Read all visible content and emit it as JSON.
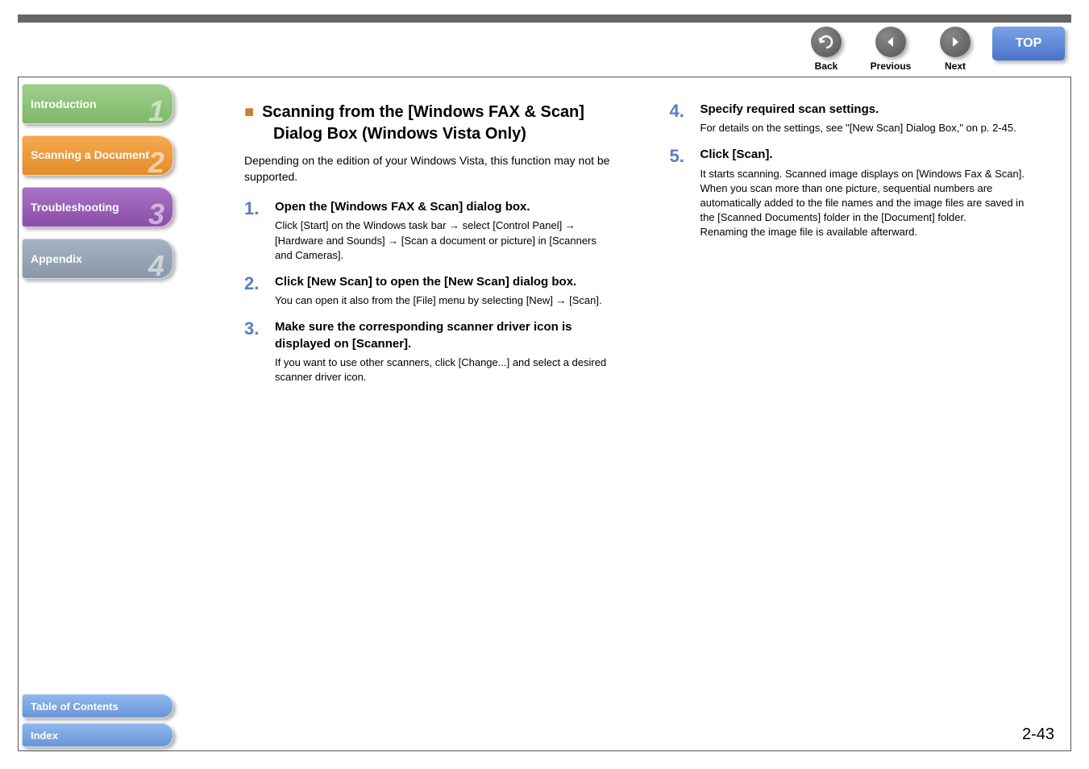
{
  "nav": {
    "back": "Back",
    "previous": "Previous",
    "next": "Next",
    "top": "TOP"
  },
  "sidebar": {
    "tabs": [
      {
        "label": "Introduction",
        "num": "1"
      },
      {
        "label": "Scanning a Document",
        "num": "2"
      },
      {
        "label": "Troubleshooting",
        "num": "3"
      },
      {
        "label": "Appendix",
        "num": "4"
      }
    ],
    "toc": "Table of Contents",
    "index": "Index"
  },
  "content": {
    "title": "Scanning from the [Windows FAX & Scan] Dialog Box (Windows Vista Only)",
    "intro": "Depending on the edition of your Windows Vista, this function may not be supported.",
    "steps": [
      {
        "num": "1.",
        "head": "Open the [Windows FAX & Scan] dialog box.",
        "desc": "Click [Start] on the Windows task bar → select [Control Panel] → [Hardware and Sounds] → [Scan a document or picture] in [Scanners and Cameras]."
      },
      {
        "num": "2.",
        "head": "Click [New Scan] to open the [New Scan] dialog box.",
        "desc": "You can open it also from the [File] menu by selecting [New] → [Scan]."
      },
      {
        "num": "3.",
        "head": "Make sure the corresponding scanner driver icon is displayed on [Scanner].",
        "desc": "If you want to use other scanners, click [Change...] and select a desired scanner driver icon."
      },
      {
        "num": "4.",
        "head": "Specify required scan settings.",
        "desc": "For details on the settings, see \"[New Scan] Dialog Box,\" on p. 2-45."
      },
      {
        "num": "5.",
        "head": "Click [Scan].",
        "desc": "It starts scanning. Scanned image displays on [Windows Fax & Scan].\nWhen you scan more than one picture, sequential numbers are automatically added to the file names and the image files are saved in the [Scanned Documents] folder in the [Document] folder.\nRenaming the image file is available afterward."
      }
    ]
  },
  "pageNum": "2-43"
}
